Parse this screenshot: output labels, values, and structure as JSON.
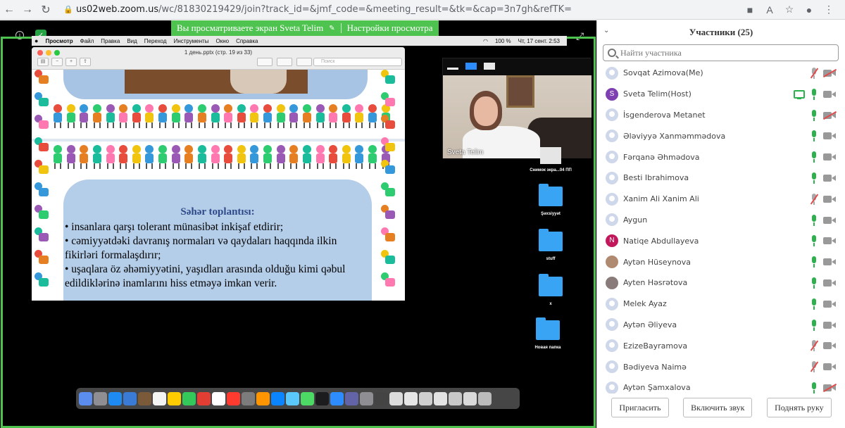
{
  "browser": {
    "url_host": "us02web.zoom.us",
    "url_path": "/wc/81830219429/join?track_id=&jmf_code=&meeting_result=&tk=&cap=3n7gh&refTK="
  },
  "share": {
    "banner_text": "Вы просматриваете экран Sveta Telim",
    "banner_settings": "Настройки просмотра"
  },
  "mac_menu": {
    "app": "Просмотр",
    "items": [
      "Файл",
      "Правка",
      "Вид",
      "Переход",
      "Инструменты",
      "Окно",
      "Справка"
    ],
    "status": "100 %",
    "clock": "Чт, 17 сент.  2:53"
  },
  "document": {
    "title": "1 день.pptx (стр. 19 из 33)",
    "search_placeholder": "Поиск"
  },
  "slide": {
    "heading": "Səhər toplantısı:",
    "lines": [
      "• insanlara qarşı tolerant münasibət inkişaf etdirir;",
      "• cəmiyyətdəki davranış normaları və qaydaları haqqında ilkin",
      "fikirləri formalaşdırır;",
      "• uşaqlara öz əhəmiyyətini, yaşıdları arasında olduğu kimi qəbul",
      "edildiklərinə inamlarını hiss etməyə imkan verir."
    ]
  },
  "video": {
    "name": "Sveta Telim"
  },
  "desktop": {
    "items": [
      "Снимок экра...04 ПП",
      "Şəxsiyyət",
      "stuff",
      "x",
      "Новая папка"
    ]
  },
  "panel": {
    "title": "Участники (25)",
    "search_placeholder": "Найти участника",
    "participants": [
      {
        "name": "Sovqat Azimova(Me)",
        "avatar": "default",
        "avatar_color": "#cfd8ea",
        "mic": "muted",
        "cam": "off"
      },
      {
        "name": "Sveta Telim(Host)",
        "avatar": "S",
        "avatar_color": "#7e3fb0",
        "mic": "on",
        "cam": "on",
        "sharing": true
      },
      {
        "name": "İsgenderova Metanet",
        "avatar": "default",
        "avatar_color": "#cfd8ea",
        "mic": "on",
        "cam": "off"
      },
      {
        "name": "Ələviyyə Xanməmmədova",
        "avatar": "default",
        "avatar_color": "#cfd8ea",
        "mic": "on",
        "cam": "on"
      },
      {
        "name": "Fərqanə Əhmədova",
        "avatar": "default",
        "avatar_color": "#cfd8ea",
        "mic": "on",
        "cam": "on"
      },
      {
        "name": "Besti Ibrahimova",
        "avatar": "default",
        "avatar_color": "#cfd8ea",
        "mic": "on",
        "cam": "on"
      },
      {
        "name": "Xanim Ali Xanim Ali",
        "avatar": "default",
        "avatar_color": "#cfd8ea",
        "mic": "muted",
        "cam": "on"
      },
      {
        "name": "Aygun",
        "avatar": "default",
        "avatar_color": "#cfd8ea",
        "mic": "on",
        "cam": "on"
      },
      {
        "name": "Natiqe Abdullayeva",
        "avatar": "N",
        "avatar_color": "#c2185b",
        "mic": "on",
        "cam": "on"
      },
      {
        "name": "Aytən Hüseynova",
        "avatar": "photo",
        "avatar_color": "#b08a70",
        "mic": "on",
        "cam": "on"
      },
      {
        "name": "Ayten Həsrətova",
        "avatar": "photo",
        "avatar_color": "#8a7b7b",
        "mic": "on",
        "cam": "on"
      },
      {
        "name": "Melek Ayaz",
        "avatar": "default",
        "avatar_color": "#cfd8ea",
        "mic": "on",
        "cam": "on"
      },
      {
        "name": "Aytən Əliyeva",
        "avatar": "default",
        "avatar_color": "#cfd8ea",
        "mic": "on",
        "cam": "on"
      },
      {
        "name": "EzizeBayramova",
        "avatar": "default",
        "avatar_color": "#cfd8ea",
        "mic": "muted",
        "cam": "on"
      },
      {
        "name": "Bədiyeva Naimə",
        "avatar": "default",
        "avatar_color": "#cfd8ea",
        "mic": "muted",
        "cam": "on"
      },
      {
        "name": "Aytən Şamxalova",
        "avatar": "default",
        "avatar_color": "#cfd8ea",
        "mic": "on",
        "cam": "off"
      }
    ],
    "buttons": {
      "invite": "Пригласить",
      "unmute": "Включить звук",
      "raise_hand": "Поднять руку"
    }
  },
  "colors": {
    "share_green": "#4ec34f",
    "mic_green": "#2cb14d",
    "muted_red": "#e04b4b"
  }
}
